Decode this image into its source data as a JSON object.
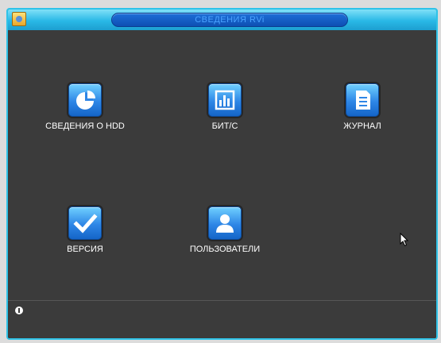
{
  "window": {
    "title": "СВЕДЕНИЯ RVi",
    "accent_color": "#2fc3e8",
    "background_color": "#3b3b3b"
  },
  "tiles": [
    {
      "label": "СВЕДЕНИЯ О HDD",
      "icon": "pie-chart-icon"
    },
    {
      "label": "БИТ/С",
      "icon": "bar-chart-icon"
    },
    {
      "label": "ЖУРНАЛ",
      "icon": "document-icon"
    },
    {
      "label": "ВЕРСИЯ",
      "icon": "checkmark-icon"
    },
    {
      "label": "ПОЛЬЗОВАТЕЛИ",
      "icon": "user-icon"
    }
  ],
  "statusbar": {
    "icon": "info-icon",
    "text": ""
  }
}
